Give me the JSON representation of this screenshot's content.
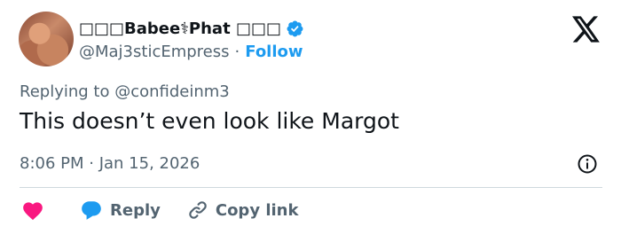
{
  "author": {
    "display_name": "□□□Babee⚕Phat □□□",
    "handle": "@Maj3sticEmpress",
    "separator": "·",
    "follow_label": "Follow",
    "verified_color": "#1d9bf0"
  },
  "tweet": {
    "replying_to": "Replying to @confideinm3",
    "text": "This doesn’t even look like Margot",
    "timestamp": "8:06 PM · Jan 15, 2026"
  },
  "actions": {
    "reply_label": "Reply",
    "copy_link_label": "Copy link"
  },
  "colors": {
    "like": "#f91880",
    "reply": "#1d9bf0",
    "secondary_text": "#536471",
    "primary_text": "#0f1419"
  },
  "icons": [
    "x-logo-icon",
    "verified-badge-icon",
    "info-icon",
    "heart-icon",
    "reply-bubble-icon",
    "link-icon"
  ]
}
